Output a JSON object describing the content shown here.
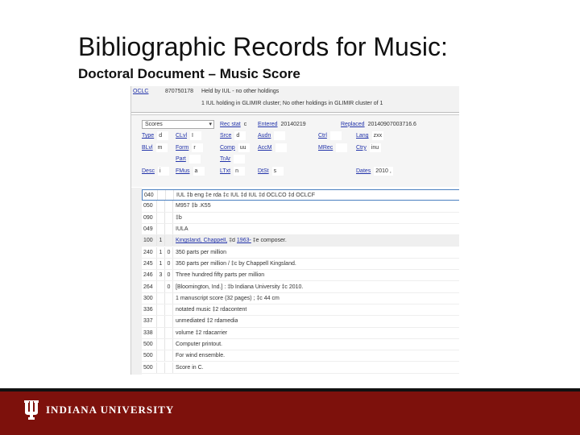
{
  "slide": {
    "title": "Bibliographic Records for Music:",
    "subtitle": "Doctoral Document – Music Score"
  },
  "header": {
    "oclc_label": "OCLC",
    "oclc_number": "870750178",
    "held": "Held by IUL - no other holdings",
    "cluster": "1 IUL holding in GLIMIR cluster; No other holdings in GLIMIR cluster of 1"
  },
  "fixed": {
    "format": "Scores",
    "rec_stat": {
      "label": "Rec stat",
      "value": "c"
    },
    "entered": {
      "label": "Entered",
      "value": "20140219"
    },
    "replaced": {
      "label": "Replaced",
      "value": "20140907003716.6"
    },
    "rows": [
      [
        {
          "label": "Type",
          "value": "d"
        },
        {
          "label": "CLvl",
          "value": "I"
        },
        {
          "label": "Srce",
          "value": "d"
        },
        {
          "label": "Audn",
          "value": ""
        },
        {
          "label": "Ctrl",
          "value": ""
        },
        {
          "label": "Lang",
          "value": "zxx"
        }
      ],
      [
        {
          "label": "BLvl",
          "value": "m"
        },
        {
          "label": "Form",
          "value": "r"
        },
        {
          "label": "Comp",
          "value": "uu"
        },
        {
          "label": "AccM",
          "value": ""
        },
        {
          "label": "MRec",
          "value": ""
        },
        {
          "label": "Ctry",
          "value": "inu"
        }
      ],
      [
        {
          "label": "",
          "value": null
        },
        {
          "label": "Part",
          "value": ""
        },
        {
          "label": "TrAr",
          "value": ""
        },
        {
          "label": "",
          "value": null
        },
        {
          "label": "",
          "value": null
        },
        {
          "label": "",
          "value": null
        }
      ],
      [
        {
          "label": "Desc",
          "value": "i"
        },
        {
          "label": "FMus",
          "value": "a"
        },
        {
          "label": "LTxt",
          "value": "n"
        },
        {
          "label": "DtSt",
          "value": "s"
        },
        {
          "label": "",
          "value": null
        },
        {
          "label": "Dates",
          "value": "2010 ,"
        }
      ]
    ]
  },
  "fields": [
    {
      "tag": "040",
      "i1": "",
      "i2": "",
      "text": "IUL ‡b eng ‡e rda ‡c IUL ‡d IUL ‡d OCLCO ‡d OCLCF"
    },
    {
      "tag": "050",
      "i1": "",
      "i2": "",
      "text": "M957 ‡b .K55"
    },
    {
      "tag": "090",
      "i1": "",
      "i2": "",
      "text": "‡b"
    },
    {
      "tag": "049",
      "i1": "",
      "i2": "",
      "text": "IULA"
    },
    {
      "tag": "100",
      "i1": "1",
      "i2": "",
      "link": "Kingsland, Chappell,",
      "link2": "1963-",
      "text_mid": " ‡d ",
      "text_end": " ‡e composer."
    },
    {
      "tag": "240",
      "i1": "1",
      "i2": "0",
      "text": "350 parts per million"
    },
    {
      "tag": "245",
      "i1": "1",
      "i2": "0",
      "text": "350 parts per million / ‡c by Chappell Kingsland."
    },
    {
      "tag": "246",
      "i1": "3",
      "i2": "0",
      "text": "Three hundred fifty parts per million"
    },
    {
      "tag": "264",
      "i1": "",
      "i2": "0",
      "text": "[Bloomington, Ind.] : ‡b Indiana University ‡c 2010."
    },
    {
      "tag": "300",
      "i1": "",
      "i2": "",
      "text": "1 manuscript score (32 pages) ; ‡c 44 cm"
    },
    {
      "tag": "336",
      "i1": "",
      "i2": "",
      "text": "notated music ‡2 rdacontent"
    },
    {
      "tag": "337",
      "i1": "",
      "i2": "",
      "text": "unmediated ‡2 rdamedia"
    },
    {
      "tag": "338",
      "i1": "",
      "i2": "",
      "text": "volume ‡2 rdacarrier"
    },
    {
      "tag": "500",
      "i1": "",
      "i2": "",
      "text": "Computer printout."
    },
    {
      "tag": "500",
      "i1": "",
      "i2": "",
      "text": "For wind ensemble."
    },
    {
      "tag": "500",
      "i1": "",
      "i2": "",
      "text": "Score in C."
    }
  ],
  "footer": {
    "logo_text": "INDIANA UNIVERSITY",
    "brand_color": "#7d110c"
  }
}
